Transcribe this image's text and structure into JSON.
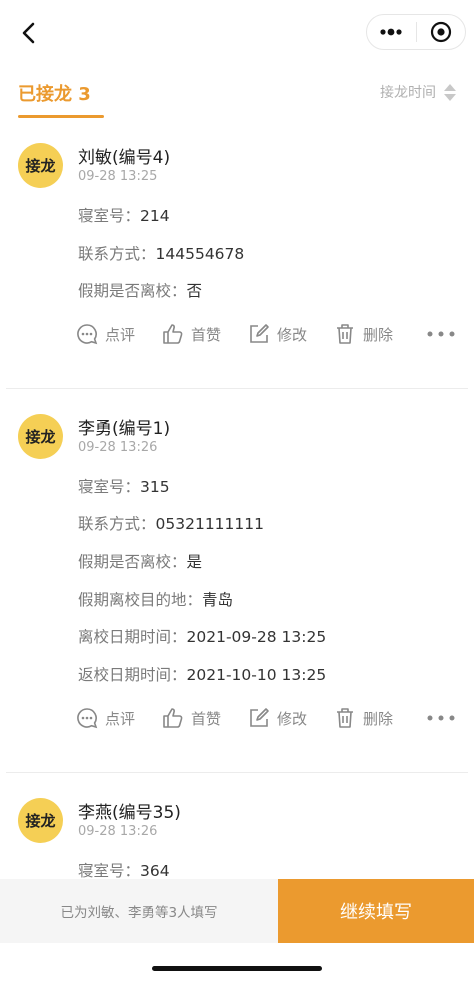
{
  "header": {
    "back_icon": "chevron-left-icon",
    "menu_icon": "more-dots-icon",
    "close_icon": "target-icon"
  },
  "tabs": {
    "active_label": "已接龙 3",
    "sort_label": "接龙时间",
    "sort_icon": "sort-arrows-icon",
    "accent_color": "#eb9a2f"
  },
  "entries": [
    {
      "avatar_label": "接龙",
      "name": "刘敏(编号4)",
      "time": "09-28 13:25",
      "fields": [
        {
          "label": "寝室号：",
          "value": "214"
        },
        {
          "label": "联系方式：",
          "value": "144554678"
        },
        {
          "label": "假期是否离校：",
          "value": "否"
        }
      ],
      "actions": [
        "点评",
        "首赞",
        "修改",
        "删除"
      ]
    },
    {
      "avatar_label": "接龙",
      "name": "李勇(编号1)",
      "time": "09-28 13:26",
      "fields": [
        {
          "label": "寝室号：",
          "value": "315"
        },
        {
          "label": "联系方式：",
          "value": "05321111111"
        },
        {
          "label": "假期是否离校：",
          "value": "是"
        },
        {
          "label": "假期离校目的地：",
          "value": "青岛"
        },
        {
          "label": "离校日期时间：",
          "value": "2021-09-28 13:25"
        },
        {
          "label": "返校日期时间：",
          "value": "2021-10-10 13:25"
        }
      ],
      "actions": [
        "点评",
        "首赞",
        "修改",
        "删除"
      ]
    },
    {
      "avatar_label": "接龙",
      "name": "李燕(编号35)",
      "time": "09-28 13:26",
      "fields": [
        {
          "label": "寝室号：",
          "value": "364"
        }
      ]
    }
  ],
  "bottom": {
    "summary": "已为刘敏、李勇等3人填写",
    "continue_label": "继续填写"
  }
}
